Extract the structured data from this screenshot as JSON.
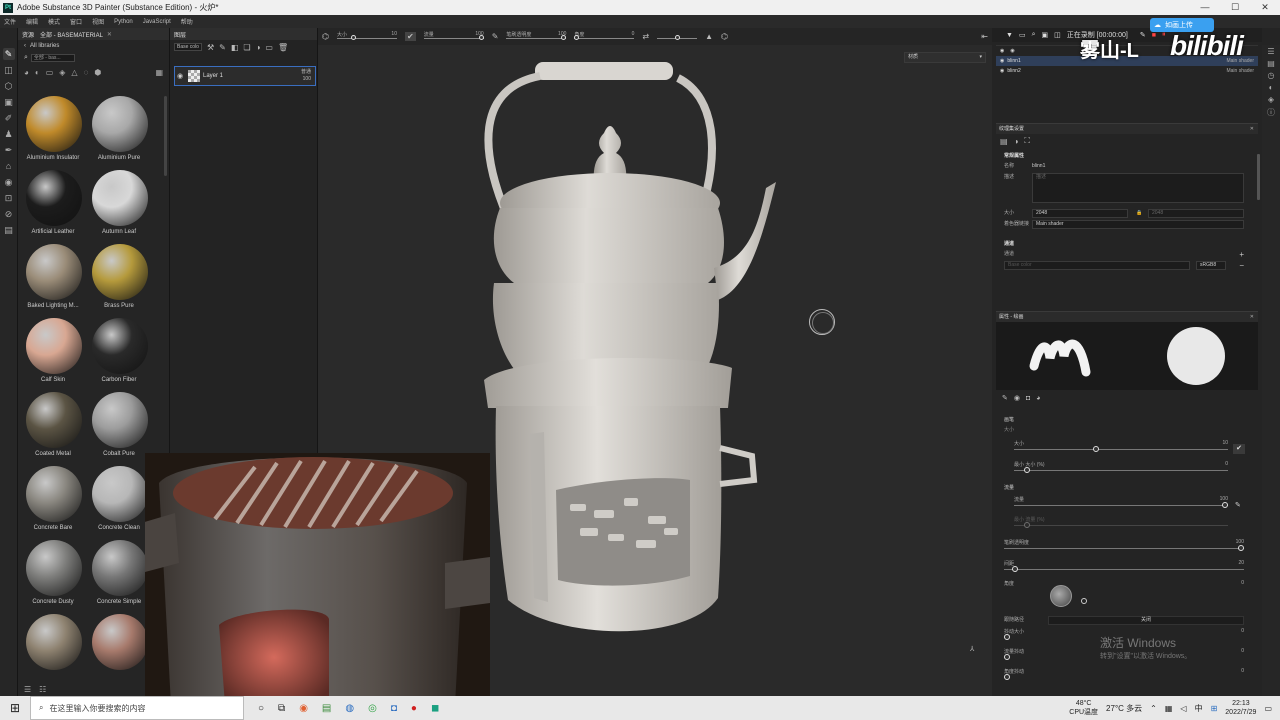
{
  "window": {
    "title": "Adobe Substance 3D Painter (Substance Edition) - 火炉*",
    "app_logo_text": "Pt",
    "controls": [
      "—",
      "☐",
      "✕"
    ]
  },
  "menu": {
    "items": [
      "文件",
      "编辑",
      "模式",
      "窗口",
      "视图",
      "Python",
      "JavaScript",
      "帮助"
    ]
  },
  "assets": {
    "title": "资源",
    "tab": "全部 - BASEMATERIAL",
    "breadcrumb": "All libraries",
    "search_placeholder": "全部 - bas...",
    "materials": [
      {
        "name": "Aluminium Insulator",
        "color": "#c08a2a"
      },
      {
        "name": "Aluminium Pure",
        "color": "#a8a8a8"
      },
      {
        "name": "Artificial Leather",
        "color": "#1c1c1c"
      },
      {
        "name": "Autumn Leaf",
        "color": "#d8d8d8"
      },
      {
        "name": "Baked Lighting M...",
        "color": "#9a8c78"
      },
      {
        "name": "Brass Pure",
        "color": "#b59a3c"
      },
      {
        "name": "Calf Skin",
        "color": "#d8a792"
      },
      {
        "name": "Carbon Fiber",
        "color": "#2a2a2a"
      },
      {
        "name": "Coated Metal",
        "color": "#5b5444"
      },
      {
        "name": "Cobalt Pure",
        "color": "#9c9c9c"
      },
      {
        "name": "Concrete Bare",
        "color": "#8a8780"
      },
      {
        "name": "Concrete Clean",
        "color": "#b7b7b7"
      },
      {
        "name": "Concrete Dusty",
        "color": "#7f7f7d"
      },
      {
        "name": "Concrete Simple",
        "color": "#777777"
      },
      {
        "name": "",
        "color": "#8e8270"
      },
      {
        "name": "",
        "color": "#a77a6c"
      }
    ]
  },
  "layers": {
    "title": "图层",
    "blend_select": "Base colo",
    "layer_name": "Layer 1",
    "layer_blend": "普通",
    "layer_opacity": "100"
  },
  "viewport_toolbar": {
    "size_label": "大小",
    "size_value": "10",
    "flow_label": "流量",
    "flow_value": "100",
    "stroke_opacity_label": "笔刷透明度",
    "stroke_opacity_value": "100",
    "angle_label": "角度",
    "angle_value": "0",
    "view_mode": "材质"
  },
  "right_top": {
    "recording_label": "正在录制 [00:00:00]",
    "cloud_button": "如画上传"
  },
  "texture_sets": {
    "rows": [
      {
        "name": "blinn1",
        "shader": "Main shader"
      },
      {
        "name": "blinn2",
        "shader": "Main shader"
      }
    ]
  },
  "texture_set_settings": {
    "title": "纹理集设置",
    "section_general": "常规属性",
    "name_label": "名称",
    "name_value": "blinn1",
    "desc_label": "描述",
    "desc_placeholder": "描述",
    "size_label": "大小",
    "size_value": "2048",
    "size_locked_value": "2048",
    "shader_label": "着色器链接",
    "shader_value": "Main shader",
    "section_channels": "通道",
    "channels_label": "通道",
    "channel_name_placeholder": "Base color",
    "channel_format": "sRGB8"
  },
  "properties": {
    "title": "属性 - 绘画",
    "section_brush": "画笔",
    "size_label": "大小",
    "size_value": "10",
    "size_value_pct": 0.37,
    "min_size_label": "最小 大小 (%)",
    "min_size_value": "0",
    "section_flow": "流量",
    "flow_label": "流量",
    "flow_value": "100",
    "min_flow_label": "最小 流量 (%)",
    "stroke_opacity_label": "笔刷透明度",
    "stroke_opacity_value": "100",
    "spacing_label": "间距",
    "spacing_value": "20",
    "angle_label": "角度",
    "angle_value": "0",
    "follow_path_label": "跟随路径",
    "follow_path_value": "关闭",
    "jitter_size_label": "抖动大小",
    "jitter_size_value": "0",
    "jitter_flow_label": "流量抖动",
    "jitter_flow_value": "0",
    "jitter_angle_label": "角度抖动",
    "jitter_angle_value": "0"
  },
  "watermark": {
    "line1": "激活 Windows",
    "line2": "转到\"设置\"以激活 Windows。"
  },
  "overlay": {
    "uploader_name": "雾山-L",
    "platform": "bilibili"
  },
  "taskbar": {
    "search_placeholder": "在这里输入你要搜索的内容",
    "cpu_temp": "48°C",
    "cpu_label": "CPU温度",
    "weather": "27°C 多云",
    "ime_lang": "中",
    "time": "22:13",
    "date": "2022/7/29"
  },
  "colors": {
    "accent": "#3a6ec0",
    "panel_bg": "#242424",
    "viewport_bg": "#2a2a2a"
  }
}
